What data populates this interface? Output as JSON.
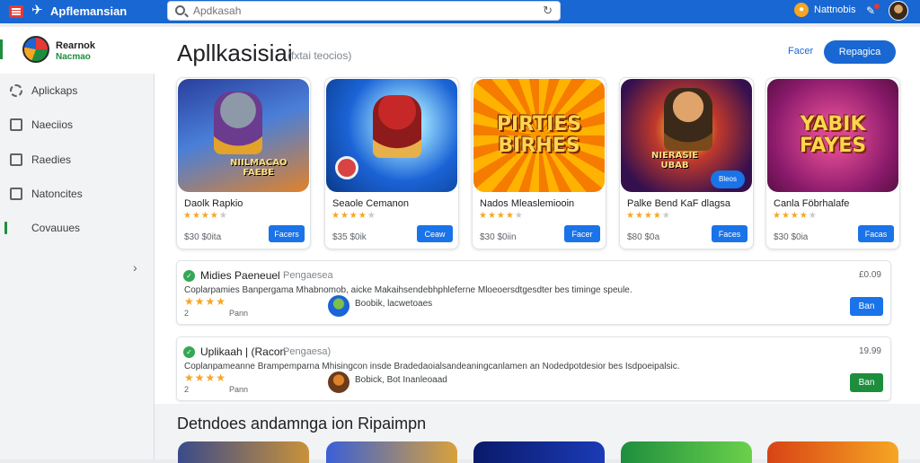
{
  "app": {
    "title": "Apflemansian"
  },
  "search": {
    "placeholder": "Apdkasah",
    "value": ""
  },
  "header": {
    "notification_label": "Nattnobis"
  },
  "profile": {
    "name": "Rearnok",
    "subtitle": "Nacmao"
  },
  "sidebar": {
    "items": [
      {
        "label": "Aplickaps",
        "icon": "gear-icon"
      },
      {
        "label": "Naeciios",
        "icon": "store-icon"
      },
      {
        "label": "Raedies",
        "icon": "list-icon"
      },
      {
        "label": "Natoncites",
        "icon": "folder-icon"
      },
      {
        "label": "Covauues",
        "icon": "circle-icon",
        "active": true
      }
    ]
  },
  "main": {
    "title": "Apllkasisiai",
    "subtitle": "(fxtai teocios)",
    "filter_label": "Facer",
    "primary_button": "Repagica"
  },
  "cards": [
    {
      "title": "Daolk Rapkio",
      "stars": 4,
      "price": "$30 $0ita",
      "button": "Facers",
      "art_line1": "NIILMACAO",
      "art_line2": "FAEBE",
      "colors": [
        "#2a3f9e",
        "#e0822a"
      ]
    },
    {
      "title": "Seaole Cemanon",
      "stars": 4,
      "price": "$35 $0ik",
      "button": "Ceaw",
      "art_line1": "",
      "art_line2": "",
      "colors": [
        "#1b63d6",
        "#58c7f5"
      ]
    },
    {
      "title": "Nados Mleaslemiooin",
      "stars": 4,
      "price": "$30 $0iin",
      "button": "Facer",
      "art_line1": "PIRTIES",
      "art_line2": "BIRHES",
      "colors": [
        "#f0a21b",
        "#e53c1a"
      ]
    },
    {
      "title": "Palke Bend KaF dlagsa",
      "stars": 4,
      "price": "$80 $0a",
      "button": "Faces",
      "art_line1": "NIERASIE",
      "art_line2": "UBAB",
      "badge": "Bleos",
      "colors": [
        "#35104f",
        "#e8641a"
      ]
    },
    {
      "title": "Canla Föbrhalafe",
      "stars": 4,
      "price": "$30 $0ia",
      "button": "Facas",
      "art_line1": "YABIK",
      "art_line2": "FAYES",
      "colors": [
        "#8a1a6b",
        "#c02f8f"
      ]
    }
  ],
  "list_items": [
    {
      "title": "Midies Paeneuel",
      "tag": "Pengaesea",
      "description": "Coplarpamies Banpergama Mhabnomob, aicke Makaihsendebhphleferne Mloeoersdtgesdter bes timinge speule.",
      "stars": "★★★★",
      "count": "2",
      "meta": "Pann",
      "developer": "Boobik, lacwetoaes",
      "price": "£0.09",
      "button": "Ban",
      "button_color": "#1a73e8",
      "avatar_colors": [
        "#1b63d6",
        "#7cc04a"
      ]
    },
    {
      "title": "Uplikaah | (Racon",
      "tag": "Pengaesa)",
      "description": "Coplanpameanne Brampemparna Mhisingcon insde Bradedaoialsandeaningcanlamen an Nodedpotdesior bes Isdpoeipalsic.",
      "stars": "★★★★",
      "count": "2",
      "meta": "Pann",
      "developer": "Bobick, Bot Inanleoaad",
      "price": "19.99",
      "button": "Ban",
      "button_color": "#1e8e3e",
      "avatar_colors": [
        "#e0822a",
        "#6b3b1a"
      ]
    }
  ],
  "section": {
    "title": "Detndoes andamnga ion Ripaimpn"
  },
  "colors": {
    "brand": "#1967d2",
    "accent_green": "#1e8e3e",
    "star": "#f6a623"
  }
}
